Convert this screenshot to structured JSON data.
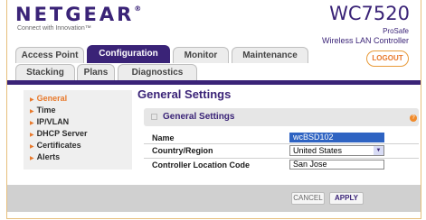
{
  "header": {
    "brand": "NETGEAR",
    "brand_mark": "®",
    "tagline": "Connect with Innovation™",
    "model": "WC7520",
    "prosafe": "ProSafe",
    "product": "Wireless LAN Controller",
    "logout_label": "LOGOUT"
  },
  "tabs": {
    "row1": [
      {
        "label": "Access Point",
        "active": false
      },
      {
        "label": "Configuration",
        "active": true
      },
      {
        "label": "Monitor",
        "active": false
      },
      {
        "label": "Maintenance",
        "active": false
      }
    ],
    "row2": [
      {
        "label": "Stacking",
        "active": false
      },
      {
        "label": "Plans",
        "active": false
      },
      {
        "label": "Diagnostics",
        "active": false
      }
    ]
  },
  "sidebar": {
    "items": [
      {
        "label": "General",
        "selected": true
      },
      {
        "label": "Time",
        "selected": false
      },
      {
        "label": "IP/VLAN",
        "selected": false
      },
      {
        "label": "DHCP Server",
        "selected": false
      },
      {
        "label": "Certificates",
        "selected": false
      },
      {
        "label": "Alerts",
        "selected": false
      }
    ]
  },
  "main": {
    "title": "General Settings",
    "section_title": "General Settings",
    "help_icon": "?",
    "fields": [
      {
        "label": "Name",
        "value": "wcBSD102"
      },
      {
        "label": "Country/Region",
        "value": "United States"
      },
      {
        "label": "Controller Location Code",
        "value": "San Jose"
      }
    ]
  },
  "footer": {
    "cancel_label": "CANCEL",
    "apply_label": "APPLY"
  },
  "colors": {
    "brand": "#3a2377",
    "accent": "#e8782a",
    "selection": "#2e63c2"
  }
}
